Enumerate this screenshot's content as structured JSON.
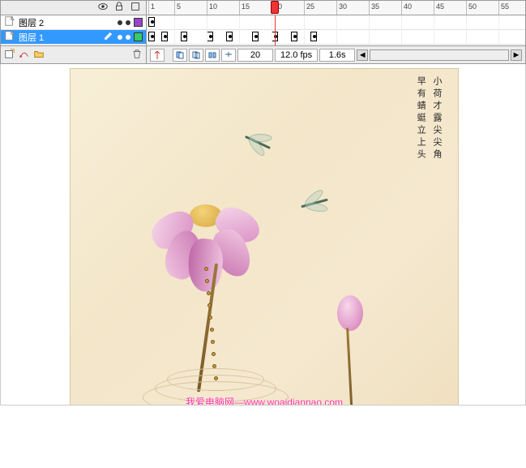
{
  "layers": {
    "items": [
      {
        "name": "图层 2",
        "selected": false,
        "color": "#9944cc"
      },
      {
        "name": "图层 1",
        "selected": true,
        "color": "#33cc66"
      }
    ]
  },
  "timeline": {
    "ruler_marks": [
      1,
      5,
      10,
      15,
      20,
      25,
      30,
      35,
      40,
      45,
      50,
      55
    ],
    "playhead_frame": 20,
    "track2_keyframes": [
      1,
      3,
      6,
      10,
      13,
      17,
      20,
      23,
      26
    ]
  },
  "status": {
    "current_frame": "20",
    "fps": "12.0 fps",
    "elapsed": "1.6s"
  },
  "stage": {
    "poem_line1": "小荷才露尖尖角",
    "poem_line2": "早有蜻蜓立上头",
    "watermark": "我爱电脑网—www.woaidiannao.com"
  }
}
